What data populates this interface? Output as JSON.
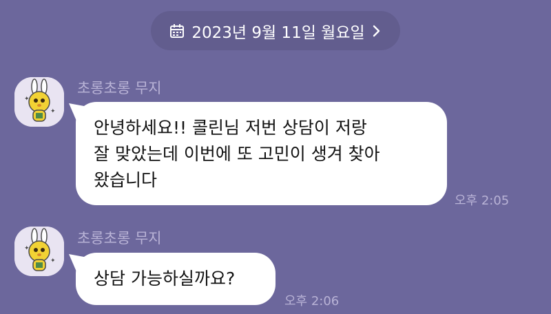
{
  "date_divider": {
    "label": "2023년 9월 11일 월요일",
    "icon": "calendar-icon",
    "chevron": "chevron-right-icon"
  },
  "messages": [
    {
      "sender": "초롱초롱 무지",
      "lines": [
        "안녕하세요!! 콜린님 저번 상담이 저랑",
        "잘 맞았는데 이번에 또 고민이 생겨 찾아",
        "왔습니다"
      ],
      "time": "오후 2:05"
    },
    {
      "sender": "초롱초롱 무지",
      "lines": [
        "상담 가능하실까요?"
      ],
      "time": "오후 2:06"
    }
  ],
  "colors": {
    "background": "#6c679c",
    "pill": "#625d8e",
    "bubble": "#ffffff",
    "meta_text": "#b9b3d6"
  }
}
